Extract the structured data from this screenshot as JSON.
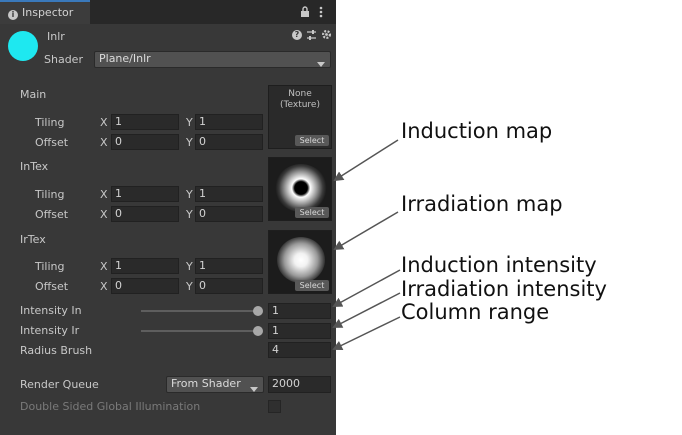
{
  "tab": {
    "title": "Inspector"
  },
  "material": {
    "name": "Inlr",
    "shader_label": "Shader",
    "shader_value": "Plane/Inlr",
    "color": "#1ee8f0"
  },
  "props": {
    "main": {
      "label": "Main",
      "tex_text": "None\n(Texture)",
      "select": "Select",
      "tiling_label": "Tiling",
      "offset_label": "Offset",
      "tiling": {
        "x": "1",
        "y": "1"
      },
      "offset": {
        "x": "0",
        "y": "0"
      }
    },
    "intex": {
      "label": "InTex",
      "select": "Select",
      "tiling_label": "Tiling",
      "offset_label": "Offset",
      "tiling": {
        "x": "1",
        "y": "1"
      },
      "offset": {
        "x": "0",
        "y": "0"
      }
    },
    "irtex": {
      "label": "IrTex",
      "select": "Select",
      "tiling_label": "Tiling",
      "offset_label": "Offset",
      "tiling": {
        "x": "1",
        "y": "1"
      },
      "offset": {
        "x": "0",
        "y": "0"
      }
    },
    "x_label": "X",
    "y_label": "Y",
    "intensity_in": {
      "label": "Intensity In",
      "value": "1"
    },
    "intensity_ir": {
      "label": "Intensity Ir",
      "value": "1"
    },
    "radius": {
      "label": "Radius Brush",
      "value": "4"
    },
    "render_queue": {
      "label": "Render Queue",
      "option": "From Shader",
      "value": "2000"
    },
    "double_sided": {
      "label": "Double Sided Global Illumination"
    }
  },
  "annotations": {
    "induction_map": "Induction map",
    "irradiation_map": "Irradiation map",
    "induction_intensity": "Induction intensity",
    "irradiation_intensity": "Irradiation intensity",
    "column_range": "Column range"
  },
  "colors": {
    "accent": "#3a79bb",
    "panel": "#383838"
  }
}
